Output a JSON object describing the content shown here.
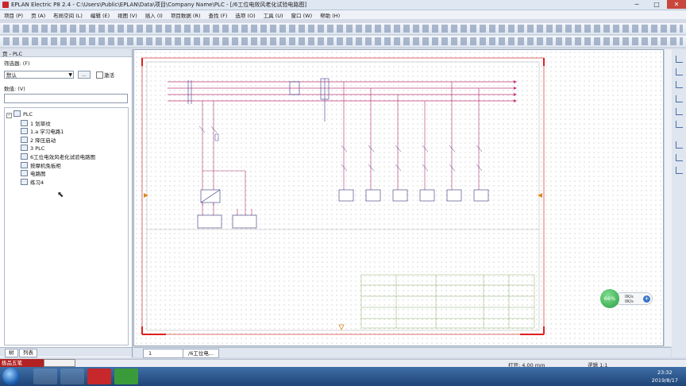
{
  "window": {
    "title": "EPLAN Electric P8 2.4 - C:\\Users\\Public\\EPLAN\\Data\\项目\\Company Name\\PLC - [/6工位电效风老化试验电路图]",
    "buttons": {
      "minimize": "─",
      "maximize": "□",
      "close": "✕"
    }
  },
  "menu": [
    {
      "label": "项目 (P)"
    },
    {
      "label": "页 (A)"
    },
    {
      "label": "布局空间 (L)"
    },
    {
      "label": "编辑 (E)"
    },
    {
      "label": "视图 (V)"
    },
    {
      "label": "插入 (I)"
    },
    {
      "label": "项目数据 (R)"
    },
    {
      "label": "查找 (F)"
    },
    {
      "label": "选项 (O)"
    },
    {
      "label": "工具 (U)"
    },
    {
      "label": "窗口 (W)"
    },
    {
      "label": "帮助 (H)"
    }
  ],
  "left_panel": {
    "header": "页 - PLC",
    "filter_label": "筛选器: (F)",
    "filter_value": "默认",
    "filter_more": "...",
    "activate_label": "激活",
    "value_label": "数值: (V)",
    "tree": {
      "root": "PLC",
      "items": [
        {
          "label": "1 划草纹"
        },
        {
          "label": "1.a 学习电路1"
        },
        {
          "label": "2 降压启动"
        },
        {
          "label": "3 PLC"
        },
        {
          "label": "6工位电效风老化试验电路图"
        },
        {
          "label": "按摩机免板柜"
        },
        {
          "label": "电路图"
        },
        {
          "label": "练习4"
        }
      ]
    },
    "tabs": [
      {
        "label": "树"
      },
      {
        "label": "列表"
      }
    ]
  },
  "doc_tabs": [
    {
      "label": "1"
    },
    {
      "label": "/6工位电..."
    }
  ],
  "status": {
    "open": "打开: 4.00 mm",
    "logic": "逻辑 1:1"
  },
  "ime": {
    "label": "极品五笔"
  },
  "net_widget": {
    "percent": "66%",
    "up": "0K/s",
    "down": "0K/s",
    "plus": "+"
  },
  "clock": {
    "time": "23:32",
    "date": "2019/8/17"
  }
}
